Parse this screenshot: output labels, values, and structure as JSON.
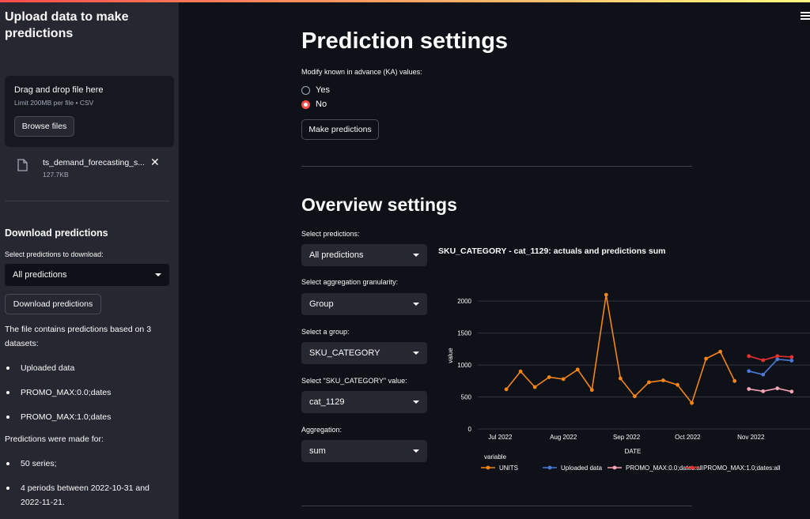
{
  "sidebar": {
    "title": "Upload data to make predictions",
    "uploader": {
      "title": "Drag and drop file here",
      "subtitle": "Limit 200MB per file • CSV",
      "browse_label": "Browse files"
    },
    "file": {
      "name": "ts_demand_forecasting_s...",
      "size": "127.7KB"
    },
    "download": {
      "heading": "Download predictions",
      "select_label": "Select predictions to download:",
      "select_value": "All predictions",
      "button_label": "Download predictions"
    },
    "info_text": "The file contains predictions based on 3 datasets:",
    "datasets": [
      "Uploaded data",
      "PROMO_MAX:0.0;dates",
      "PROMO_MAX:1.0;dates"
    ],
    "made_for_text": "Predictions were made for:",
    "made_for": [
      "50 series;",
      "4 periods between 2022-10-31 and 2022-11-21."
    ]
  },
  "prediction_settings": {
    "title": "Prediction settings",
    "ka_label": "Modify known in advance (KA) values:",
    "options": [
      "Yes",
      "No"
    ],
    "selected": "No",
    "button_label": "Make predictions"
  },
  "overview_settings": {
    "title": "Overview settings",
    "controls": [
      {
        "label": "Select predictions:",
        "value": "All predictions"
      },
      {
        "label": "Select aggregation granularity:",
        "value": "Group"
      },
      {
        "label": "Select a group:",
        "value": "SKU_CATEGORY"
      },
      {
        "label": "Select \"SKU_CATEGORY\" value:",
        "value": "cat_1129"
      },
      {
        "label": "Aggregation:",
        "value": "sum"
      }
    ]
  },
  "colors": {
    "accent": "#ff4b4b",
    "units": "#f58518",
    "uploaded": "#4c78db",
    "promo0": "#f4a4b4",
    "promo1": "#e8302f"
  },
  "chart_data": {
    "type": "line",
    "title": "SKU_CATEGORY - cat_1129: actuals and predictions sum",
    "xlabel": "DATE",
    "ylabel": "value",
    "xticks": [
      "Jul 2022",
      "Aug 2022",
      "Sep 2022",
      "Oct 2022",
      "Nov 2022"
    ],
    "yticks": [
      "0",
      "500",
      "1000",
      "1500",
      "2000"
    ],
    "ylim": [
      0,
      2200
    ],
    "xlim": [
      "2022-06-20",
      "2022-11-30"
    ],
    "legend_title": "variable",
    "legend_position": "bottom",
    "series": [
      {
        "name": "UNITS",
        "marker": true,
        "points": [
          [
            "2022-07-04",
            620
          ],
          [
            "2022-07-11",
            900
          ],
          [
            "2022-07-18",
            655
          ],
          [
            "2022-07-25",
            810
          ],
          [
            "2022-08-01",
            780
          ],
          [
            "2022-08-08",
            930
          ],
          [
            "2022-08-15",
            610
          ],
          [
            "2022-08-22",
            2100
          ],
          [
            "2022-08-29",
            790
          ],
          [
            "2022-09-05",
            510
          ],
          [
            "2022-09-12",
            730
          ],
          [
            "2022-09-19",
            760
          ],
          [
            "2022-09-26",
            690
          ],
          [
            "2022-10-03",
            405
          ],
          [
            "2022-10-10",
            1100
          ],
          [
            "2022-10-17",
            1210
          ],
          [
            "2022-10-24",
            750
          ]
        ]
      },
      {
        "name": "Uploaded data",
        "marker": true,
        "points": [
          [
            "2022-10-31",
            905
          ],
          [
            "2022-11-07",
            850
          ],
          [
            "2022-11-14",
            1090
          ],
          [
            "2022-11-21",
            1070
          ]
        ]
      },
      {
        "name": "PROMO_MAX:0.0;dates:all",
        "marker": true,
        "points": [
          [
            "2022-10-31",
            625
          ],
          [
            "2022-11-07",
            590
          ],
          [
            "2022-11-14",
            635
          ],
          [
            "2022-11-21",
            585
          ]
        ]
      },
      {
        "name": "PROMO_MAX:1.0;dates:all",
        "marker": true,
        "points": [
          [
            "2022-10-31",
            1140
          ],
          [
            "2022-11-07",
            1075
          ],
          [
            "2022-11-14",
            1140
          ],
          [
            "2022-11-21",
            1125
          ]
        ]
      }
    ]
  }
}
